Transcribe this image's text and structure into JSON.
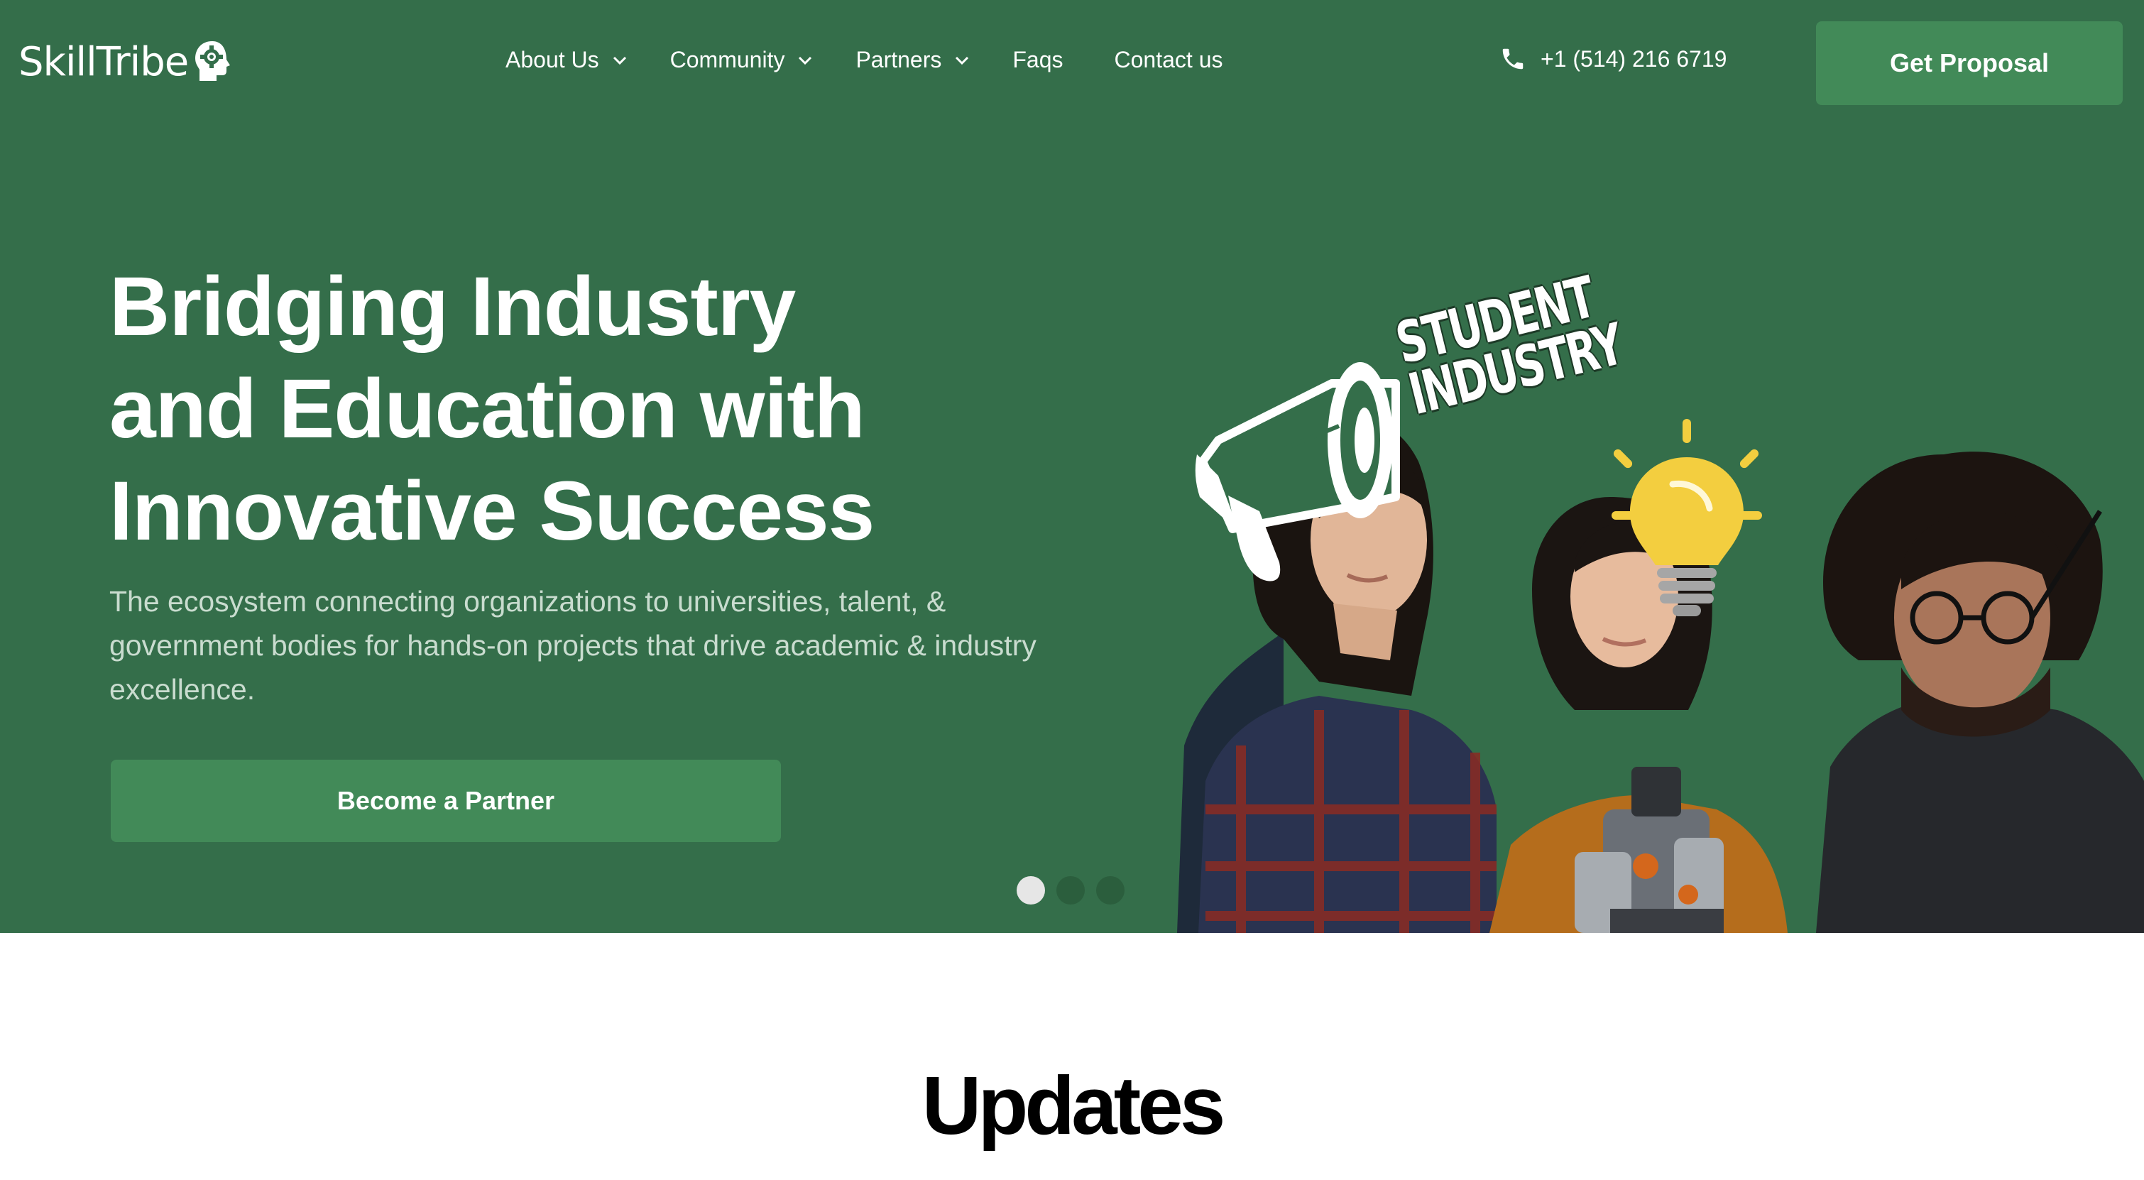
{
  "colors": {
    "brand": "#346e4a",
    "button": "#428a58",
    "subtext": "#c9dccf"
  },
  "nav": {
    "logo": "SkillTribe",
    "items": [
      {
        "label": "About Us",
        "dropdown": true
      },
      {
        "label": "Community",
        "dropdown": true
      },
      {
        "label": "Partners",
        "dropdown": true
      },
      {
        "label": "Faqs",
        "dropdown": false
      },
      {
        "label": "Contact us",
        "dropdown": false
      }
    ],
    "phone": "+1 (514) 216 6719",
    "cta": "Get Proposal"
  },
  "hero": {
    "headline": [
      "Bridging Industry",
      "and Education with",
      "Innovative Success"
    ],
    "subtext": "The ecosystem connecting organizations to universities, talent, & government bodies for hands-on projects that drive academic & industry excellence.",
    "cta": "Become a Partner",
    "badge": [
      "STUDENT",
      "INDUSTRY"
    ],
    "slides": {
      "count": 3,
      "active": 1
    }
  },
  "updates": {
    "title": "Updates"
  }
}
